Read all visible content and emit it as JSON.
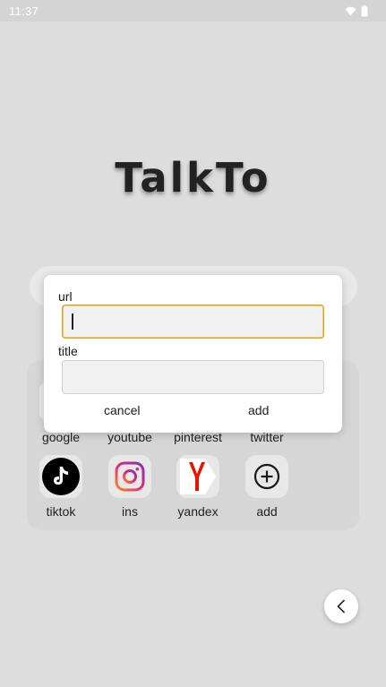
{
  "status_bar": {
    "time": "11:37"
  },
  "app": {
    "title": "TalkTo"
  },
  "shortcuts": {
    "row1": [
      {
        "label": "google"
      },
      {
        "label": "youtube"
      },
      {
        "label": "pinterest"
      },
      {
        "label": "twitter"
      }
    ],
    "row2": [
      {
        "label": "tiktok",
        "icon": "tiktok-icon"
      },
      {
        "label": "ins",
        "icon": "instagram-icon"
      },
      {
        "label": "yandex",
        "icon": "yandex-icon"
      },
      {
        "label": "add",
        "icon": "add-circle-icon"
      }
    ]
  },
  "dialog": {
    "url_label": "url",
    "url_value": "",
    "title_label": "title",
    "title_value": "",
    "cancel_label": "cancel",
    "add_label": "add"
  },
  "colors": {
    "background": "#dddddd",
    "focus_border": "#e0a112",
    "instagram_pink": "#d6249f",
    "yandex_red": "#e61400"
  }
}
